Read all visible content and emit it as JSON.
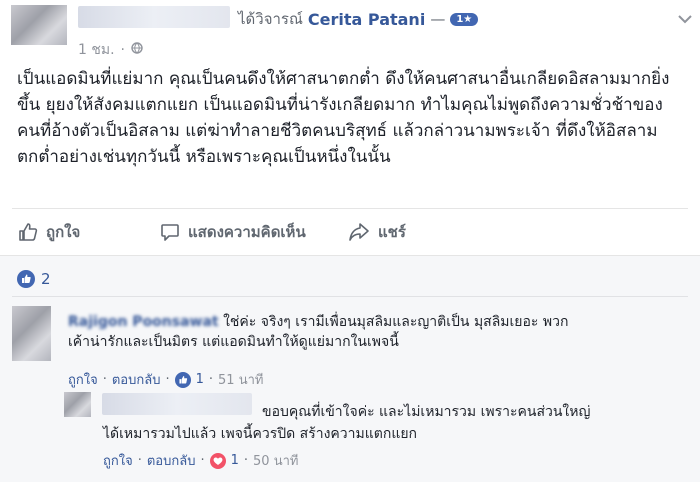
{
  "post": {
    "reviewed_text": "ได้วิจารณ์",
    "page_name": "Cerita Patani",
    "rating_dash": "—",
    "rating_badge": "1★",
    "time": "1 ชม.",
    "body": "เป็นแอดมินที่แย่มาก คุณเป็นคนดึงให้ศาสนาตกต่ำ ดึงให้คนศาสนาอื่นเกลียดอิสลามมากยิ่งขึ้น ยุยงให้สังคมแตกแยก เป็นแอดมินที่น่ารังเกลียดมาก ทำไมคุณไม่พูดถึงความชั่วช้าของคนที่อ้างตัวเป็นอิสลาม แต่ฆ่าทำลายชีวิตคนบริสุทธ์ แล้วกล่าวนามพระเจ้า ที่ดึงให้อิสลามตกต่ำอย่างเช่นทุกวันนี้ หรือเพราะคุณเป็นหนึ่งในนั้น"
  },
  "actions": {
    "like": "ถูกใจ",
    "comment": "แสดงความคิดเห็น",
    "share": "แชร์"
  },
  "reactions": {
    "count": "2"
  },
  "comments": [
    {
      "author": "Rajigon Poonsawat",
      "text_line1": "ใช่ค่ะ จริงๆ เรามีเพื่อนมุสลิมและญาติเป็น มุสลิมเยอะ พวก",
      "text_line2": "เค้าน่ารักและเป็นมิตร แต่แอดมินทำให้ดูแย่มากในเพจนี้",
      "like": "ถูกใจ",
      "reply": "ตอบกลับ",
      "reaction_count": "1",
      "time": "51 นาที"
    },
    {
      "text_line1": "ขอบคุณที่เข้าใจค่ะ และไม่เหมารวม เพราะคนส่วนใหญ่",
      "text_line2": "ได้เหมารวมไปแล้ว เพจนี้ควรปิด สร้างความแตกแยก",
      "like": "ถูกใจ",
      "reply": "ตอบกลับ",
      "reaction_count": "1",
      "time": "50 นาที"
    }
  ],
  "colors": {
    "fb_blue": "#4267b2",
    "heart": "#f25268",
    "text": "#1d2129",
    "meta": "#90949c"
  }
}
